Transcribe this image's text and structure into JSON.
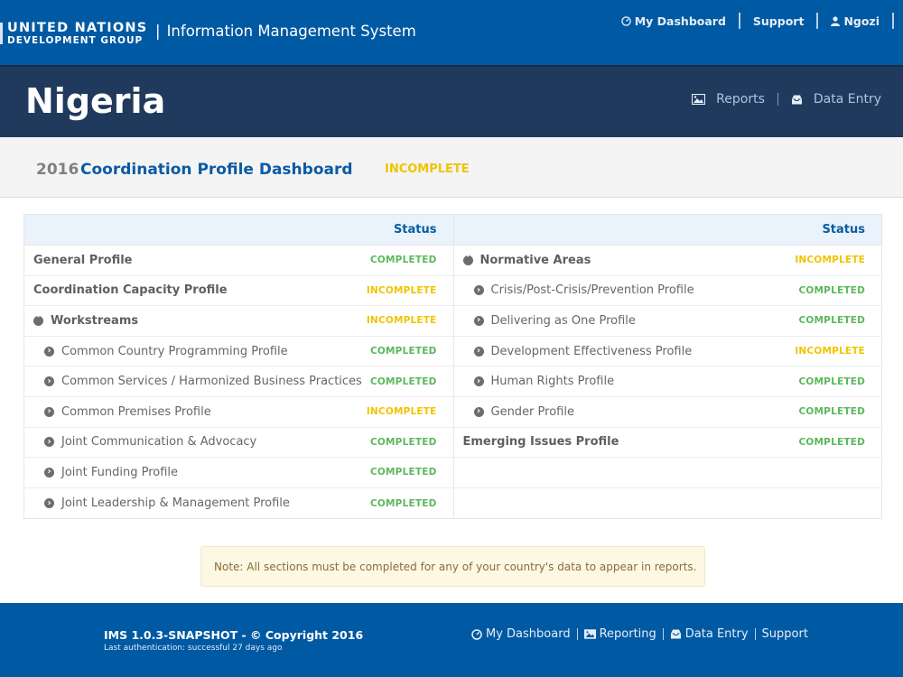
{
  "header": {
    "logo_line1": "UNITED NATIONS",
    "logo_line2": "DEVELOPMENT GROUP",
    "app_title": "Information Management System",
    "nav": [
      {
        "label": "My Dashboard",
        "icon": "dashboard-gauge-icon"
      },
      {
        "label": "Support",
        "icon": ""
      },
      {
        "label": "Ngozi",
        "icon": "user-icon"
      }
    ]
  },
  "country": {
    "name": "Nigeria",
    "nav": [
      {
        "label": "Reports",
        "icon": "picture-icon"
      },
      {
        "label": "Data Entry",
        "icon": "inbox-icon"
      }
    ]
  },
  "dashboard": {
    "year": "2016",
    "title": "Coordination Profile Dashboard",
    "status": "INCOMPLETE"
  },
  "colors": {
    "completed": "#5cb85c",
    "incomplete": "#f0c400",
    "brand_blue": "#0059a3",
    "dark_navy": "#1f3a5c"
  },
  "tables": {
    "status_header": "Status",
    "left": [
      {
        "label": "General Profile",
        "status": "COMPLETED",
        "level": "top",
        "icon": ""
      },
      {
        "label": "Coordination Capacity Profile",
        "status": "INCOMPLETE",
        "level": "top",
        "icon": ""
      },
      {
        "label": "Workstreams",
        "status": "INCOMPLETE",
        "level": "group",
        "icon": "chevron-circle-down-icon"
      },
      {
        "label": "Common Country Programming Profile",
        "status": "COMPLETED",
        "level": "sub",
        "icon": "chevron-circle-right-icon"
      },
      {
        "label": "Common Services / Harmonized Business Practices",
        "status": "COMPLETED",
        "level": "sub",
        "icon": "chevron-circle-right-icon"
      },
      {
        "label": "Common Premises Profile",
        "status": "INCOMPLETE",
        "level": "sub",
        "icon": "chevron-circle-right-icon"
      },
      {
        "label": "Joint Communication & Advocacy",
        "status": "COMPLETED",
        "level": "sub",
        "icon": "chevron-circle-right-icon"
      },
      {
        "label": "Joint Funding Profile",
        "status": "COMPLETED",
        "level": "sub",
        "icon": "chevron-circle-right-icon"
      },
      {
        "label": "Joint Leadership & Management Profile",
        "status": "COMPLETED",
        "level": "sub",
        "icon": "chevron-circle-right-icon"
      }
    ],
    "right": [
      {
        "label": "Normative Areas",
        "status": "INCOMPLETE",
        "level": "group",
        "icon": "chevron-circle-down-icon"
      },
      {
        "label": "Crisis/Post-Crisis/Prevention Profile",
        "status": "COMPLETED",
        "level": "sub",
        "icon": "chevron-circle-right-icon"
      },
      {
        "label": "Delivering as One Profile",
        "status": "COMPLETED",
        "level": "sub",
        "icon": "chevron-circle-right-icon"
      },
      {
        "label": "Development Effectiveness Profile",
        "status": "INCOMPLETE",
        "level": "sub",
        "icon": "chevron-circle-right-icon"
      },
      {
        "label": "Human Rights Profile",
        "status": "COMPLETED",
        "level": "sub",
        "icon": "chevron-circle-right-icon"
      },
      {
        "label": "Gender Profile",
        "status": "COMPLETED",
        "level": "sub",
        "icon": "chevron-circle-right-icon"
      },
      {
        "label": "Emerging Issues Profile",
        "status": "COMPLETED",
        "level": "top",
        "icon": ""
      },
      {
        "label": "",
        "status": "",
        "level": "empty",
        "icon": ""
      },
      {
        "label": "",
        "status": "",
        "level": "empty",
        "icon": ""
      }
    ]
  },
  "note": "Note: All sections must be completed for any of your country's data to appear in reports.",
  "footer": {
    "version": "IMS 1.0.3-SNAPSHOT - © Copyright 2016",
    "auth": "Last authentication: successful 27 days ago",
    "nav": [
      {
        "label": "My Dashboard",
        "icon": "dashboard-gauge-icon"
      },
      {
        "label": "Reporting",
        "icon": "picture-icon"
      },
      {
        "label": "Data Entry",
        "icon": "inbox-icon"
      },
      {
        "label": "Support",
        "icon": ""
      }
    ]
  }
}
